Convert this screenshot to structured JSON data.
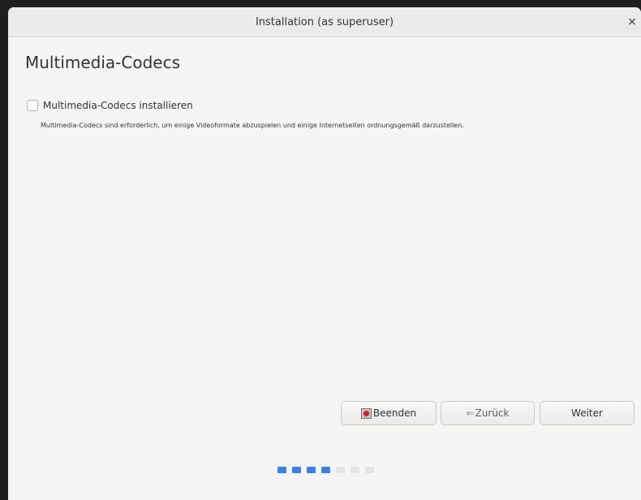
{
  "window": {
    "title": "Installation (as superuser)",
    "close_glyph": "×"
  },
  "page": {
    "title": "Multimedia-Codecs",
    "checkbox_label": "Multimedia-Codecs installieren",
    "checkbox_checked": false,
    "description": "Multimedia-Codecs sind erforderlich, um einige Videoformate abzuspielen und einige Internetseiten ordnungsgemäß darzustellen."
  },
  "buttons": {
    "quit_label": "Beenden",
    "quit_icon": "quit-icon",
    "back_label": "Zurück",
    "back_icon": "back-arrow-icon",
    "back_glyph": "⇐",
    "next_label": "Weiter"
  },
  "progress": {
    "completed": 4,
    "total": 7,
    "active_color": "#3584e4",
    "inactive_color": "#e6e4e2"
  }
}
